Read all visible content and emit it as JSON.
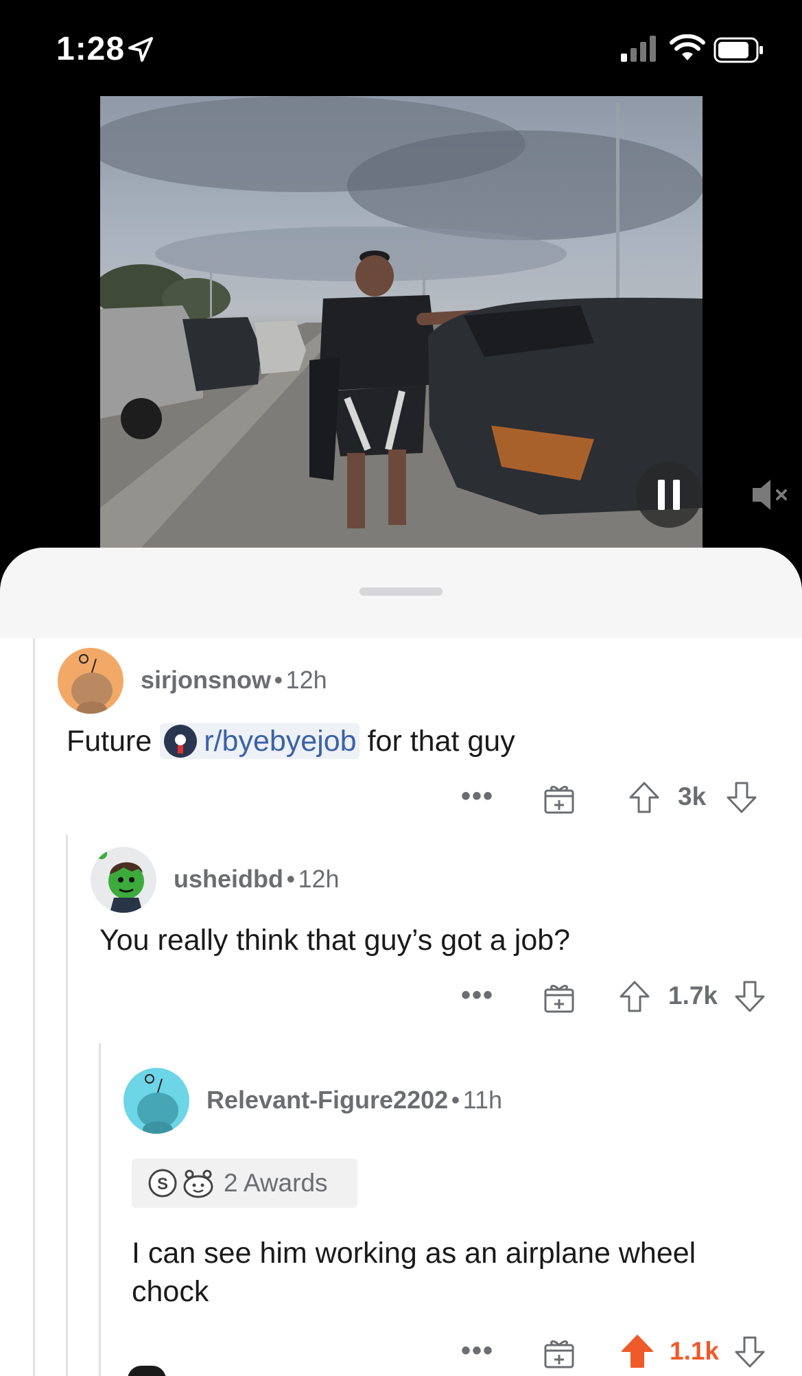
{
  "status_bar": {
    "time": "1:28"
  },
  "comments": [
    {
      "username": "sirjonsnow",
      "separator": "•",
      "age": "12h",
      "text_before": "Future",
      "subreddit_link": "r/byebyejob",
      "text_after": "for that guy",
      "more": "•••",
      "votes": "3k",
      "avatar_color": "#f2a968"
    },
    {
      "username": "usheidbd",
      "separator": "•",
      "age": "12h",
      "text": "You really think that guy’s got a job?",
      "more": "•••",
      "votes": "1.7k",
      "avatar_color": "#e9eaec"
    },
    {
      "username": "Relevant-Figure2202",
      "separator": "•",
      "age": "11h",
      "awards": "2 Awards",
      "text": "I can see him working as an airplane wheel chock",
      "more": "•••",
      "votes": "1.1k",
      "upvoted": true,
      "avatar_color": "#6cd5e6"
    }
  ],
  "colors": {
    "upvote_active": "#ee5a29",
    "link": "#3a62a8",
    "meta": "#6b6d70"
  }
}
